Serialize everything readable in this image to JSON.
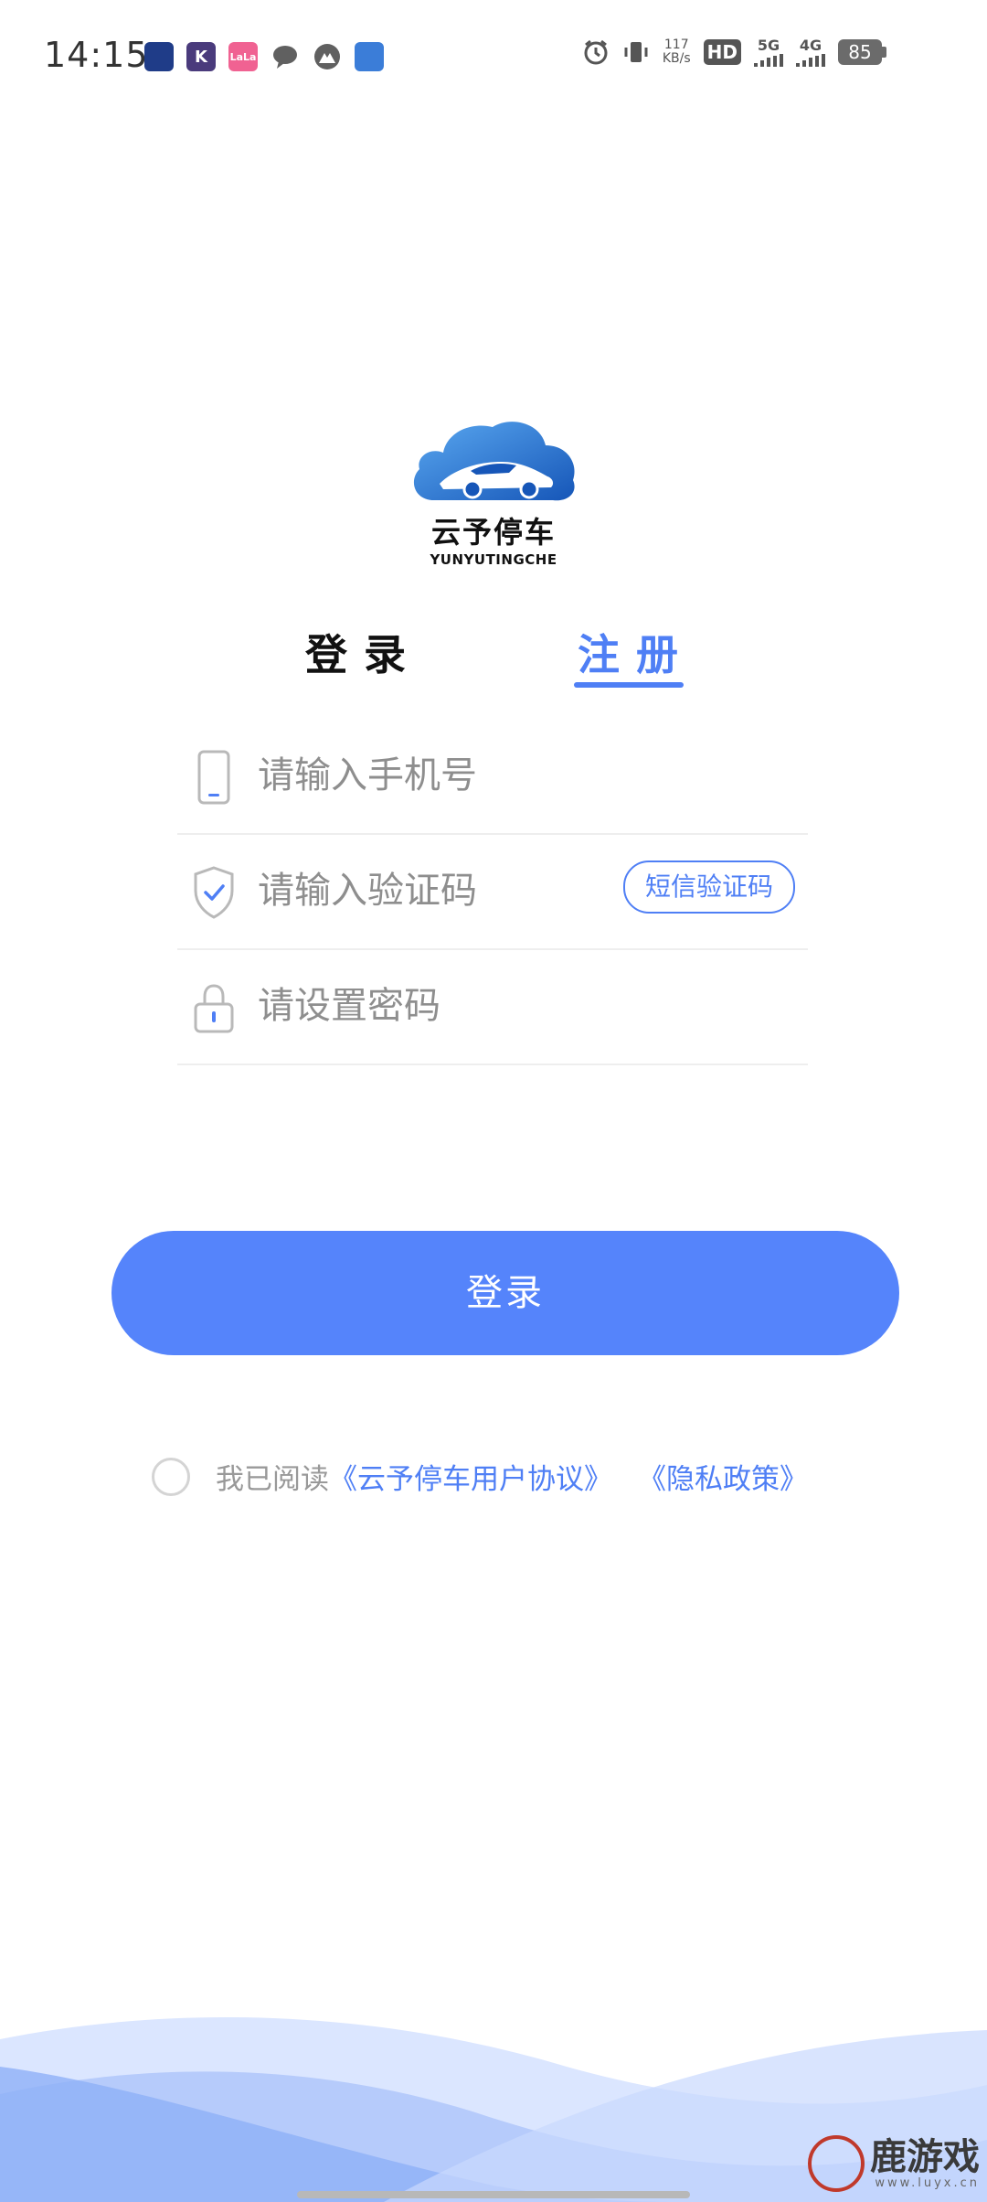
{
  "status_bar": {
    "time": "14:15",
    "app_icons": [
      {
        "name": "news-app-icon",
        "color": "#1f3c88"
      },
      {
        "name": "k-app-icon",
        "color": "#4a3b7c",
        "text": "K"
      },
      {
        "name": "lala-app-icon",
        "color": "#f06292",
        "text": "LaLa"
      },
      {
        "name": "message-app-icon",
        "color": "#606060"
      },
      {
        "name": "mountain-app-icon",
        "color": "#606060"
      },
      {
        "name": "game-app-icon",
        "color": "#3b7dd8"
      }
    ],
    "network_speed_value": "117",
    "network_speed_unit": "KB/s",
    "hd_label": "HD",
    "signal_5g": "5G",
    "signal_4g": "4G",
    "battery": "85"
  },
  "logo": {
    "name_cn": "云予停车",
    "name_en": "YUNYUTINGCHE"
  },
  "tabs": {
    "login": "登录",
    "register": "注册",
    "active": "register"
  },
  "form": {
    "phone_placeholder": "请输入手机号",
    "code_placeholder": "请输入验证码",
    "sms_button": "短信验证码",
    "password_placeholder": "请设置密码"
  },
  "submit_label": "登录",
  "agreement": {
    "prefix": "我已阅读",
    "user_agreement": "《云予停车用户协议》",
    "privacy_policy": "《隐私政策》"
  },
  "watermark": {
    "text": "鹿游戏",
    "sub": "www.luyx.cn"
  },
  "colors": {
    "accent": "#4f7ff5",
    "button": "#5584fb",
    "wave_light": "#dbe6ff",
    "wave_dark": "#8fb0f8"
  }
}
